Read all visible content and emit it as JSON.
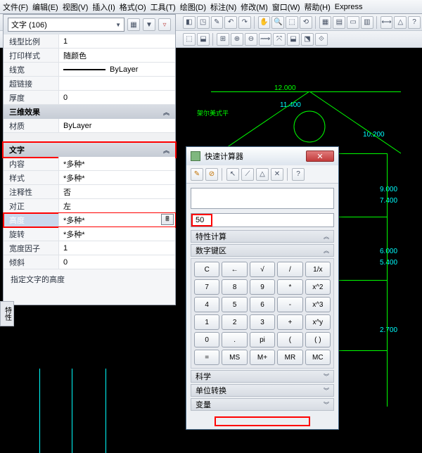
{
  "menu": {
    "file": "文件(F)",
    "edit": "编辑(E)",
    "view": "视图(V)",
    "insert": "插入(I)",
    "format": "格式(O)",
    "tools": "工具(T)",
    "draw": "绘图(D)",
    "dim": "标注(N)",
    "modify": "修改(M)",
    "window": "窗口(W)",
    "help": "帮助(H)",
    "express": "Express"
  },
  "panel": {
    "selector": "文字 (106)",
    "rows": {
      "lt_scale": {
        "label": "线型比例",
        "value": "1"
      },
      "plot_style": {
        "label": "打印样式",
        "value": "随颜色"
      },
      "lineweight": {
        "label": "线宽",
        "value": "ByLayer"
      },
      "hyperlink": {
        "label": "超链接",
        "value": ""
      },
      "thickness": {
        "label": "厚度",
        "value": "0"
      }
    },
    "sec_3d": "三维效果",
    "rows3d": {
      "material": {
        "label": "材质",
        "value": "ByLayer"
      }
    },
    "sec_text": "文字",
    "rows_text": {
      "content": {
        "label": "内容",
        "value": "*多种*"
      },
      "style": {
        "label": "样式",
        "value": "*多种*"
      },
      "annot": {
        "label": "注释性",
        "value": "否"
      },
      "justify": {
        "label": "对正",
        "value": "左"
      },
      "height": {
        "label": "高度",
        "value": "*多种*"
      },
      "rotate": {
        "label": "旋转",
        "value": "*多种*"
      },
      "wfactor": {
        "label": "宽度因子",
        "value": "1"
      },
      "oblique": {
        "label": "倾斜",
        "value": "0"
      }
    },
    "help": "指定文字的高度"
  },
  "sidetab": "特性",
  "calc": {
    "title": "快速计算器",
    "input": "50",
    "sec_prop": "特性计算",
    "sec_keys": "数字键区",
    "keys": [
      [
        "C",
        "←",
        "√",
        "/",
        "1/x"
      ],
      [
        "7",
        "8",
        "9",
        "*",
        "x^2"
      ],
      [
        "4",
        "5",
        "6",
        "-",
        "x^3"
      ],
      [
        "1",
        "2",
        "3",
        "+",
        "x^y"
      ],
      [
        "0",
        ".",
        "pi",
        "(",
        "( )"
      ],
      [
        "=",
        "MS",
        "M+",
        "MR",
        "MC"
      ]
    ],
    "sec_sci": "科学",
    "sec_unit": "单位转换",
    "sec_var": "变量"
  },
  "dims": {
    "d1": "12.000",
    "d2": "11.400",
    "d3": "10.200",
    "d4": "9.000",
    "d5": "7.400",
    "d6": "6.000",
    "d7": "5.400",
    "d8": "2.700"
  },
  "label1": "架尔美式平"
}
